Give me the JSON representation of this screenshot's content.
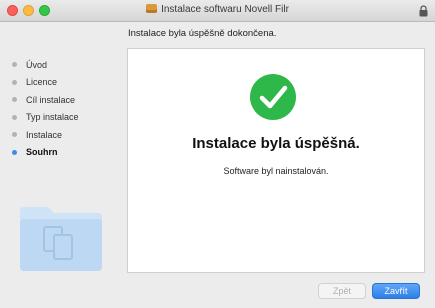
{
  "window": {
    "title": "Instalace softwaru Novell Filr"
  },
  "header": {
    "text": "Instalace byla úspěšně dokončena."
  },
  "sidebar": {
    "items": [
      {
        "label": "Úvod",
        "active": false
      },
      {
        "label": "Licence",
        "active": false
      },
      {
        "label": "Cíl instalace",
        "active": false
      },
      {
        "label": "Typ instalace",
        "active": false
      },
      {
        "label": "Instalace",
        "active": false
      },
      {
        "label": "Souhrn",
        "active": true
      }
    ]
  },
  "content": {
    "title": "Instalace byla úspěšná.",
    "message": "Software byl nainstalován."
  },
  "buttons": {
    "back": "Zpět",
    "close": "Zavřít"
  },
  "colors": {
    "accent": "#3b8de7",
    "success": "#2fb84a"
  }
}
